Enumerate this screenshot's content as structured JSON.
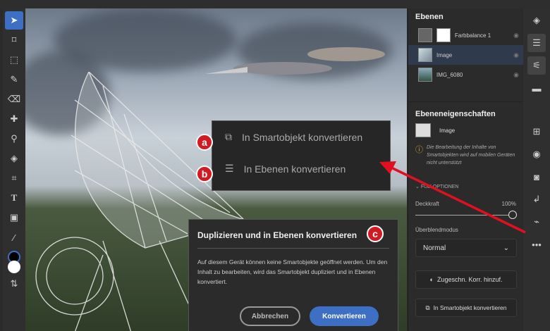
{
  "layers_panel": {
    "title": "Ebenen",
    "layers": [
      {
        "name": "Farbbalance 1"
      },
      {
        "name": "Image"
      },
      {
        "name": "IMG_6080"
      }
    ]
  },
  "properties": {
    "title": "Ebeneneigenschaften",
    "layer_name": "Image",
    "warning": "Die Bearbeitung der Inhalte von Smartobjekten wird auf mobilen Geräten nicht unterstützt",
    "section": "FÜLLOPTIONEN",
    "opacity_label": "Deckkraft",
    "opacity_value": "100%",
    "opacity": 100,
    "blend_label": "Überblendmodus",
    "blend_value": "Normal",
    "clip_adjust": "Zugeschn. Korr. hinzuf.",
    "convert_smart": "In Smartobjekt konvertieren"
  },
  "context_menu": {
    "items": [
      {
        "badge": "a",
        "label": "In Smartobjekt konvertieren"
      },
      {
        "badge": "b",
        "label": "In Ebenen konvertieren"
      }
    ]
  },
  "dialog": {
    "badge": "c",
    "title": "Duplizieren und in Ebenen konvertieren",
    "body": "Auf diesem Gerät können keine Smartobjekte geöffnet werden. Um den Inhalt zu bearbeiten, wird das Smartobjekt dupliziert und in Ebenen konvertiert.",
    "cancel": "Abbrechen",
    "confirm": "Konvertieren"
  },
  "colors": {
    "accent": "#3d6fc4",
    "annotation": "#d21a22"
  }
}
